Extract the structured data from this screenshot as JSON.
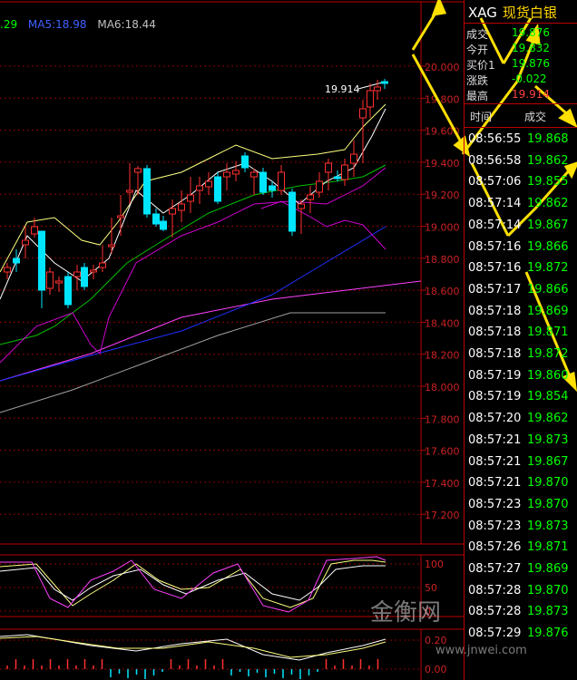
{
  "legend": {
    "ma_first_fragment": ".29",
    "ma5": "MA5:18.98",
    "ma6": "MA6:18.44"
  },
  "price_axis": [
    "20.000",
    "19.800",
    "19.600",
    "19.400",
    "19.200",
    "19.000",
    "18.800",
    "18.600",
    "18.400",
    "18.200",
    "18.000",
    "17.800",
    "17.600",
    "17.400",
    "17.200"
  ],
  "last_price_label": "19.914",
  "kdj_axis": [
    "100",
    "50",
    "0"
  ],
  "macd_axis": [
    "0.20",
    "0.00"
  ],
  "quote": {
    "symbol": "XAG",
    "name": "现货白银",
    "rows": [
      {
        "label": "成交",
        "value": "19.876",
        "color": "green"
      },
      {
        "label": "今开",
        "value": "19.832",
        "color": "green"
      },
      {
        "label": "买价1",
        "value": "19.876",
        "color": "green"
      },
      {
        "label": "涨跌",
        "value": "-0.022",
        "color": "green"
      },
      {
        "label": "最高",
        "value": "19.914",
        "color": "red"
      }
    ]
  },
  "ticks_header": {
    "time": "时间",
    "price": "成交"
  },
  "ticks": [
    {
      "time": "08:56:55",
      "price": "19.868"
    },
    {
      "time": "08:56:58",
      "price": "19.862"
    },
    {
      "time": "08:57:06",
      "price": "19.855"
    },
    {
      "time": "08:57:14",
      "price": "19.862"
    },
    {
      "time": "08:57:14",
      "price": "19.867"
    },
    {
      "time": "08:57:16",
      "price": "19.866"
    },
    {
      "time": "08:57:16",
      "price": "19.872"
    },
    {
      "time": "08:57:17",
      "price": "19.866"
    },
    {
      "time": "08:57:18",
      "price": "19.869"
    },
    {
      "time": "08:57:18",
      "price": "19.871"
    },
    {
      "time": "08:57:18",
      "price": "19.872"
    },
    {
      "time": "08:57:19",
      "price": "19.860"
    },
    {
      "time": "08:57:19",
      "price": "19.854"
    },
    {
      "time": "08:57:20",
      "price": "19.862"
    },
    {
      "time": "08:57:21",
      "price": "19.873"
    },
    {
      "time": "08:57:21",
      "price": "19.867"
    },
    {
      "time": "08:57:21",
      "price": "19.870"
    },
    {
      "time": "08:57:23",
      "price": "19.870"
    },
    {
      "time": "08:57:23",
      "price": "19.873"
    },
    {
      "time": "08:57:26",
      "price": "19.871"
    },
    {
      "time": "08:57:27",
      "price": "19.869"
    },
    {
      "time": "08:57:28",
      "price": "19.870"
    },
    {
      "time": "08:57:28",
      "price": "19.873"
    },
    {
      "time": "08:57:29",
      "price": "19.876"
    }
  ],
  "watermark": {
    "text": "金衡网",
    "url": "www.jnwei.com"
  },
  "colors": {
    "axis_red": "#cc2222",
    "up": "#ff3030",
    "down": "#00e5ff",
    "yellow": "#ffe000",
    "green": "#00ff00"
  }
}
